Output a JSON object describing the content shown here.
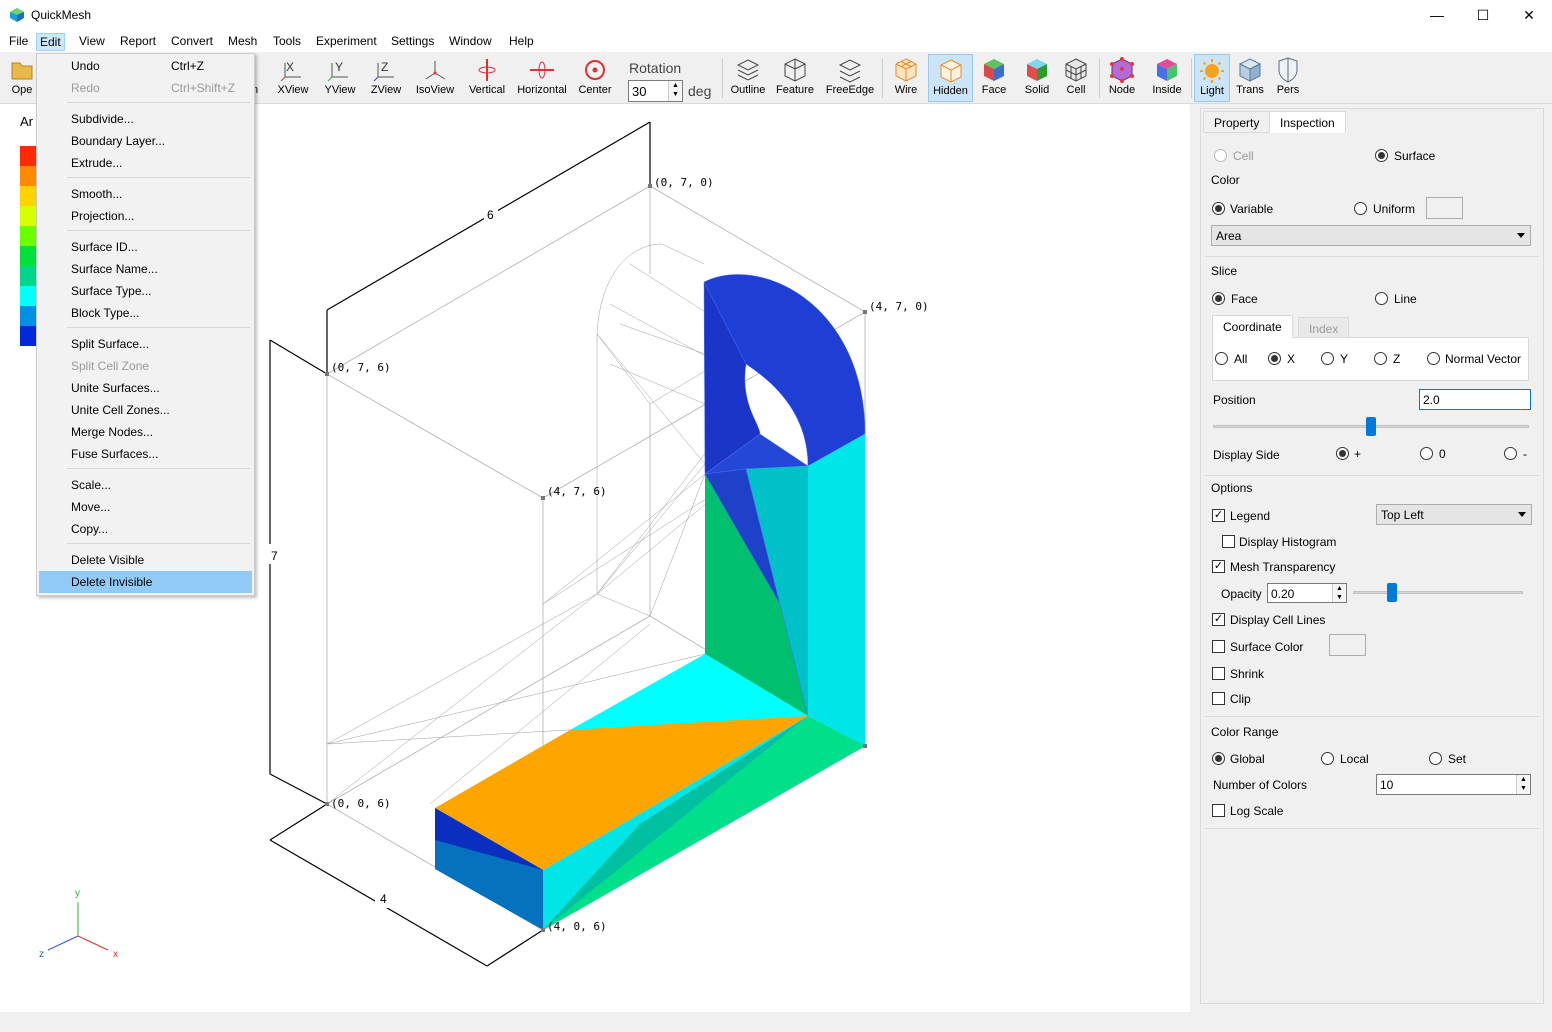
{
  "window": {
    "title": "QuickMesh",
    "minimize": "—",
    "maximize": "☐",
    "close": "✕"
  },
  "menubar": {
    "items": [
      "File",
      "Edit",
      "View",
      "Report",
      "Convert",
      "Mesh",
      "Tools",
      "Experiment",
      "Settings",
      "Window",
      "Help"
    ],
    "active": "Edit"
  },
  "toolbar": {
    "open": "Ope",
    "hidden_partial": "n",
    "xview": "XView",
    "yview": "YView",
    "zview": "ZView",
    "isoview": "IsoView",
    "vertical": "Vertical",
    "horizontal": "Horizontal",
    "center": "Center",
    "rotation_label": "Rotation",
    "rotation_value": "30",
    "rotation_unit": "deg",
    "outline": "Outline",
    "feature": "Feature",
    "freeedge": "FreeEdge",
    "wire": "Wire",
    "hidden": "Hidden",
    "face": "Face",
    "solid": "Solid",
    "cell": "Cell",
    "node": "Node",
    "inside": "Inside",
    "light": "Light",
    "trans": "Trans",
    "pers": "Pers"
  },
  "edit_menu": {
    "undo": "Undo",
    "undo_shortcut": "Ctrl+Z",
    "redo": "Redo",
    "redo_shortcut": "Ctrl+Shift+Z",
    "subdivide": "Subdivide...",
    "boundary_layer": "Boundary Layer...",
    "extrude": "Extrude...",
    "smooth": "Smooth...",
    "projection": "Projection...",
    "surface_id": "Surface ID...",
    "surface_name": "Surface Name...",
    "surface_type": "Surface Type...",
    "block_type": "Block Type...",
    "split_surface": "Split Surface...",
    "split_cell_zone": "Split Cell Zone",
    "unite_surfaces": "Unite Surfaces...",
    "unite_cell_zones": "Unite Cell Zones...",
    "merge_nodes": "Merge Nodes...",
    "fuse_surfaces": "Fuse Surfaces...",
    "scale": "Scale...",
    "move": "Move...",
    "copy": "Copy...",
    "delete_visible": "Delete Visible",
    "delete_invisible": "Delete Invisible"
  },
  "viewport": {
    "legend_title_partial": "Ar",
    "legend_colors": [
      "#ff2a00",
      "#ff8a00",
      "#ffd200",
      "#d8ff00",
      "#6cff00",
      "#00e23a",
      "#00d68c",
      "#00ffff",
      "#0091e6",
      "#0029d8"
    ],
    "coords": {
      "p070": "(0, 7, 0)",
      "p470": "(4, 7, 0)",
      "p076": "(0, 7, 6)",
      "p476": "(4, 7, 6)",
      "p006": "(0, 0, 6)",
      "p406": "(4, 0, 6)"
    },
    "dims": {
      "d6": "6",
      "d7": "7",
      "d4": "4"
    },
    "axes": {
      "x": "x",
      "y": "y",
      "z": "z"
    }
  },
  "panel": {
    "tabs": [
      "Property",
      "Inspection"
    ],
    "active_tab": "Inspection",
    "cell": "Cell",
    "surface": "Surface",
    "color_label": "Color",
    "variable": "Variable",
    "uniform": "Uniform",
    "variable_value": "Area",
    "slice_label": "Slice",
    "face": "Face",
    "line": "Line",
    "subtabs": [
      "Coordinate",
      "Index"
    ],
    "axis_all": "All",
    "axis_x": "X",
    "axis_y": "Y",
    "axis_z": "Z",
    "normal_vector": "Normal Vector",
    "position_label": "Position",
    "position_value": "2.0",
    "position_slider": 0.5,
    "display_side_label": "Display Side",
    "side_plus": "+",
    "side_zero": "0",
    "side_minus": "-",
    "options_label": "Options",
    "legend": "Legend",
    "legend_position": "Top Left",
    "display_histogram": "Display Histogram",
    "mesh_transparency": "Mesh Transparency",
    "opacity_label": "Opacity",
    "opacity_value": "0.20",
    "opacity_slider": 0.2,
    "display_cell_lines": "Display Cell Lines",
    "surface_color": "Surface Color",
    "shrink": "Shrink",
    "clip": "Clip",
    "color_range_label": "Color Range",
    "global": "Global",
    "local": "Local",
    "set": "Set",
    "number_of_colors_label": "Number of Colors",
    "number_of_colors_value": "10",
    "log_scale": "Log Scale"
  }
}
